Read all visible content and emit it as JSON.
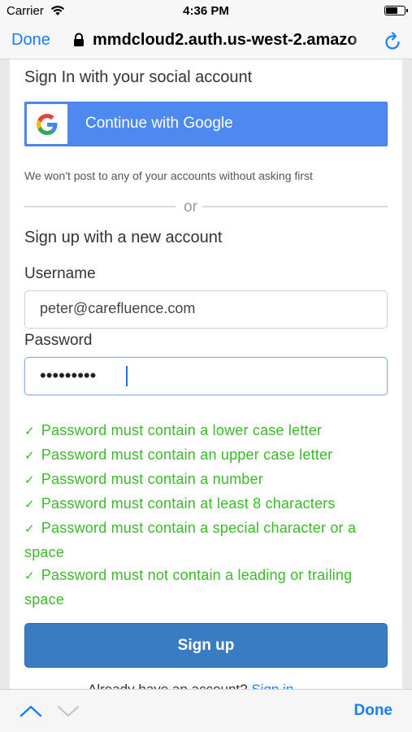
{
  "status_bar": {
    "carrier": "Carrier",
    "time": "4:36 PM"
  },
  "browser": {
    "done_label": "Done",
    "url": "mmdcloud2.auth.us-west-2.amazo"
  },
  "social": {
    "heading": "Sign In with your social account",
    "google_button_label": "Continue with Google",
    "privacy_note": "We won't post to any of your accounts without asking first",
    "divider_text": "or"
  },
  "signup": {
    "heading": "Sign up with a new account",
    "username_label": "Username",
    "username_value": "peter@carefluence.com",
    "password_label": "Password",
    "password_masked": "•••••••••",
    "rules": [
      "Password must contain a lower case letter",
      "Password must contain an upper case letter",
      "Password must contain a number",
      "Password must contain at least 8 characters",
      "Password must contain a special character or a space",
      "Password must not contain a leading or trailing space"
    ],
    "rule_check": "✓",
    "button_label": "Sign up",
    "signin_prompt": "Already have an account?",
    "signin_link": "Sign in"
  },
  "keyboard_bar": {
    "done_label": "Done"
  },
  "colors": {
    "accent_blue": "#147efb",
    "google_blue": "#4d89ef",
    "signup_blue": "#3a7cc1",
    "valid_green": "#3aba28"
  }
}
